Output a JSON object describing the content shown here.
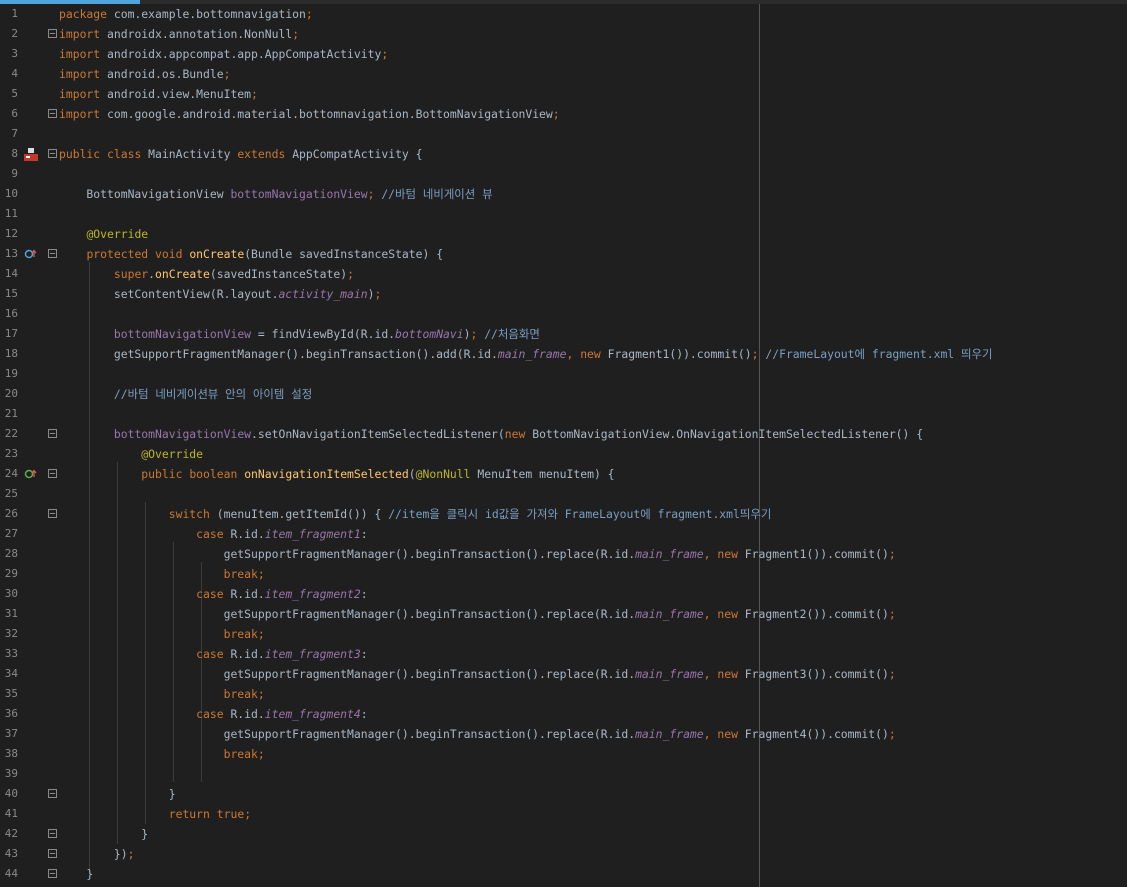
{
  "editor": {
    "lines": [
      {
        "n": "1",
        "code": "package com.example.bottomnavigation;"
      },
      {
        "n": "2",
        "code": "import androidx.annotation.NonNull;"
      },
      {
        "n": "3",
        "code": "import androidx.appcompat.app.AppCompatActivity;"
      },
      {
        "n": "4",
        "code": "import android.os.Bundle;"
      },
      {
        "n": "5",
        "code": "import android.view.MenuItem;"
      },
      {
        "n": "6",
        "code": "import com.google.android.material.bottomnavigation.BottomNavigationView;"
      },
      {
        "n": "7",
        "code": ""
      },
      {
        "n": "8",
        "code": "public class MainActivity extends AppCompatActivity {"
      },
      {
        "n": "9",
        "code": ""
      },
      {
        "n": "10",
        "code": "    BottomNavigationView bottomNavigationView; //바텀 네비게이션 뷰"
      },
      {
        "n": "11",
        "code": ""
      },
      {
        "n": "12",
        "code": "    @Override"
      },
      {
        "n": "13",
        "code": "    protected void onCreate(Bundle savedInstanceState) {"
      },
      {
        "n": "14",
        "code": "        super.onCreate(savedInstanceState);"
      },
      {
        "n": "15",
        "code": "        setContentView(R.layout.activity_main);"
      },
      {
        "n": "16",
        "code": ""
      },
      {
        "n": "17",
        "code": "        bottomNavigationView = findViewById(R.id.bottomNavi); //처음화면"
      },
      {
        "n": "18",
        "code": "        getSupportFragmentManager().beginTransaction().add(R.id.main_frame, new Fragment1()).commit(); //FrameLayout에 fragment.xml 띄우기"
      },
      {
        "n": "19",
        "code": ""
      },
      {
        "n": "20",
        "code": "        //바텀 네비게이션뷰 안의 아이템 설정"
      },
      {
        "n": "21",
        "code": ""
      },
      {
        "n": "22",
        "code": "        bottomNavigationView.setOnNavigationItemSelectedListener(new BottomNavigationView.OnNavigationItemSelectedListener() {"
      },
      {
        "n": "23",
        "code": "            @Override"
      },
      {
        "n": "24",
        "code": "            public boolean onNavigationItemSelected(@NonNull MenuItem menuItem) {"
      },
      {
        "n": "25",
        "code": ""
      },
      {
        "n": "26",
        "code": "                switch (menuItem.getItemId()) { //item을 클릭시 id값을 가져와 FrameLayout에 fragment.xml띄우기"
      },
      {
        "n": "27",
        "code": "                    case R.id.item_fragment1:"
      },
      {
        "n": "28",
        "code": "                        getSupportFragmentManager().beginTransaction().replace(R.id.main_frame, new Fragment1()).commit();"
      },
      {
        "n": "29",
        "code": "                        break;"
      },
      {
        "n": "30",
        "code": "                    case R.id.item_fragment2:"
      },
      {
        "n": "31",
        "code": "                        getSupportFragmentManager().beginTransaction().replace(R.id.main_frame, new Fragment2()).commit();"
      },
      {
        "n": "32",
        "code": "                        break;"
      },
      {
        "n": "33",
        "code": "                    case R.id.item_fragment3:"
      },
      {
        "n": "34",
        "code": "                        getSupportFragmentManager().beginTransaction().replace(R.id.main_frame, new Fragment3()).commit();"
      },
      {
        "n": "35",
        "code": "                        break;"
      },
      {
        "n": "36",
        "code": "                    case R.id.item_fragment4:"
      },
      {
        "n": "37",
        "code": "                        getSupportFragmentManager().beginTransaction().replace(R.id.main_frame, new Fragment4()).commit();"
      },
      {
        "n": "38",
        "code": "                        break;"
      },
      {
        "n": "39",
        "code": ""
      },
      {
        "n": "40",
        "code": "                }"
      },
      {
        "n": "41",
        "code": "                return true;"
      },
      {
        "n": "42",
        "code": "            }"
      },
      {
        "n": "43",
        "code": "        });"
      },
      {
        "n": "44",
        "code": "    }"
      }
    ]
  },
  "colors": {
    "background": "#1f1f1f",
    "accent": "#4ea6dc",
    "keyword": "#cc7832",
    "annotation": "#bbb529",
    "comment": "#7a9fc2",
    "function": "#ffc66d",
    "field": "#9876aa"
  }
}
